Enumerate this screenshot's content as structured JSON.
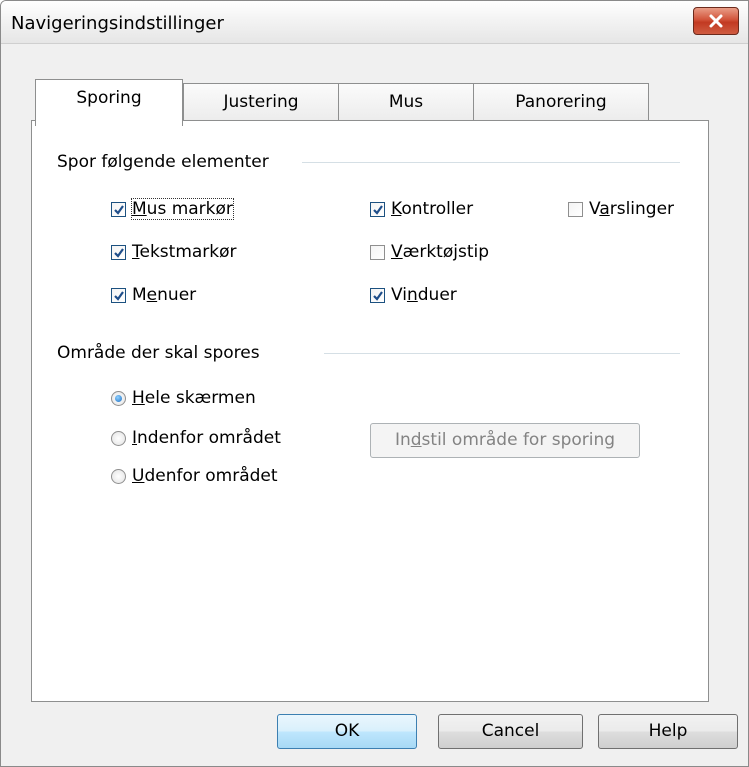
{
  "window": {
    "title": "Navigeringsindstillinger",
    "close_glyph": "×"
  },
  "tabs": [
    {
      "label": "Sporing",
      "active": true
    },
    {
      "label": "Justering",
      "active": false
    },
    {
      "label": "Mus",
      "active": false
    },
    {
      "label": "Panorering",
      "active": false
    }
  ],
  "track_group": {
    "label": "Spor følgende elementer",
    "items": [
      {
        "pre": "",
        "key": "M",
        "post": "us markør",
        "checked": true
      },
      {
        "pre": "",
        "key": "K",
        "post": "ontroller",
        "checked": true
      },
      {
        "pre": "V",
        "key": "a",
        "post": "rslinger",
        "checked": false
      },
      {
        "pre": "",
        "key": "T",
        "post": "ekstmarkør",
        "checked": true
      },
      {
        "pre": "",
        "key": "V",
        "post": "ærktøjstip",
        "checked": false
      },
      {
        "pre": "M",
        "key": "e",
        "post": "nuer",
        "checked": true
      },
      {
        "pre": "Vi",
        "key": "n",
        "post": "duer",
        "checked": true
      }
    ]
  },
  "area_group": {
    "label": "Område der skal spores",
    "options": [
      {
        "pre": "",
        "key": "H",
        "post": "ele skærmen",
        "selected": true
      },
      {
        "pre": "",
        "key": "I",
        "post": "ndenfor området",
        "selected": false
      },
      {
        "pre": "",
        "key": "U",
        "post": "denfor området",
        "selected": false
      }
    ],
    "set_area_button": {
      "pre": "In",
      "key": "d",
      "post": "stil område for sporing",
      "enabled": false
    }
  },
  "buttons": {
    "ok": "OK",
    "cancel": "Cancel",
    "help": "Help"
  },
  "colors": {
    "close_red": "#c23a22",
    "check_blue": "#1f4e8a",
    "default_button": "#3c7fb1"
  }
}
